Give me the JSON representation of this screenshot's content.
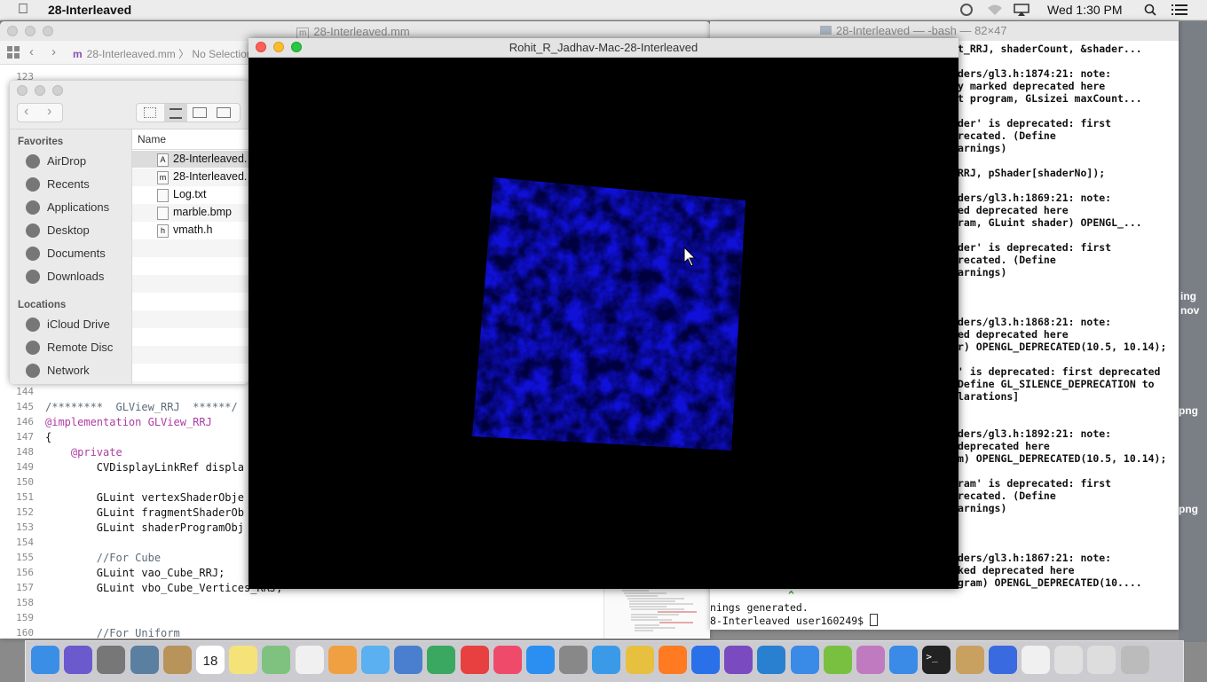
{
  "menubar": {
    "app_name": "28-Interleaved",
    "clock": "Wed 1:30 PM"
  },
  "xcode": {
    "title": "28-Interleaved.mm",
    "breadcrumb_file": "28-Interleaved.mm",
    "breadcrumb_sep": "〉",
    "breadcrumb_selection": "No Selection",
    "top_line_number": "123",
    "lines": [
      {
        "n": "144",
        "text": ""
      },
      {
        "n": "145",
        "text": "/********  GLView_RRJ  ******/",
        "kind": "comment"
      },
      {
        "n": "146",
        "text": "@implementation GLView_RRJ",
        "kind": "impl"
      },
      {
        "n": "147",
        "text": "{"
      },
      {
        "n": "148",
        "text": "    @private",
        "kind": "keyword"
      },
      {
        "n": "149",
        "text": "        CVDisplayLinkRef displa"
      },
      {
        "n": "150",
        "text": ""
      },
      {
        "n": "151",
        "text": "        GLuint vertexShaderObje"
      },
      {
        "n": "152",
        "text": "        GLuint fragmentShaderOb"
      },
      {
        "n": "153",
        "text": "        GLuint shaderProgramObj"
      },
      {
        "n": "154",
        "text": ""
      },
      {
        "n": "155",
        "text": "        //For Cube",
        "kind": "comment"
      },
      {
        "n": "156",
        "text": "        GLuint vao_Cube_RRJ;"
      },
      {
        "n": "157",
        "text": "        GLuint vbo_Cube_Vertices_RRJ;"
      },
      {
        "n": "158",
        "text": ""
      },
      {
        "n": "159",
        "text": ""
      },
      {
        "n": "160",
        "text": "        //For Uniform",
        "kind": "comment"
      }
    ]
  },
  "terminal": {
    "title": "28-Interleaved — -bash — 82×47",
    "lines": [
      "t_RRJ, shaderCount, &shader...",
      "",
      "ders/gl3.h:1874:21: note:",
      "y marked deprecated here",
      "t program, GLsizei maxCount...",
      "",
      "der' is deprecated: first",
      "recated. (Define",
      "arnings)",
      "",
      "RRJ, pShader[shaderNo]);",
      "",
      "ders/gl3.h:1869:21: note:",
      "ed deprecated here",
      "ram, GLuint shader) OPENGL_...",
      "",
      "der' is deprecated: first",
      "recated. (Define",
      "arnings)",
      "",
      "",
      "",
      "ders/gl3.h:1868:21: note:",
      "ed deprecated here",
      "r) OPENGL_DEPRECATED(10.5, 10.14);",
      "",
      "' is deprecated: first deprecated",
      "Define GL_SILENCE_DEPRECATION to",
      "larations]",
      "",
      "",
      "ders/gl3.h:1892:21: note:",
      "deprecated here",
      "m) OPENGL_DEPRECATED(10.5, 10.14);",
      "",
      "ram' is deprecated: first",
      "recated. (Define",
      "arnings)",
      "",
      "",
      "",
      "ders/gl3.h:1867:21: note:",
      "ked deprecated here",
      "gram) OPENGL_DEPRECATED(10...."
    ],
    "caret_line": "^",
    "warnings_line": "nings generated.",
    "prompt_line": "8-Interleaved user160249$ "
  },
  "desktop": {
    "labels": [
      "ing",
      "nov",
      "png",
      "png"
    ]
  },
  "finder": {
    "favorites_header": "Favorites",
    "locations_header": "Locations",
    "favorites": [
      {
        "label": "AirDrop",
        "icon": "airdrop-icon"
      },
      {
        "label": "Recents",
        "icon": "recents-icon"
      },
      {
        "label": "Applications",
        "icon": "applications-icon"
      },
      {
        "label": "Desktop",
        "icon": "desktop-icon"
      },
      {
        "label": "Documents",
        "icon": "documents-icon"
      },
      {
        "label": "Downloads",
        "icon": "downloads-icon"
      }
    ],
    "locations": [
      {
        "label": "iCloud Drive",
        "icon": "icloud-icon"
      },
      {
        "label": "Remote Disc",
        "icon": "disc-icon"
      },
      {
        "label": "Network",
        "icon": "network-icon"
      }
    ],
    "column_name": "Name",
    "files": [
      {
        "name": "28-Interleaved.",
        "glyph": "A",
        "selected": true
      },
      {
        "name": "28-Interleaved.",
        "glyph": "m",
        "selected": false
      },
      {
        "name": "Log.txt",
        "glyph": "",
        "selected": false
      },
      {
        "name": "marble.bmp",
        "glyph": "",
        "selected": false
      },
      {
        "name": "vmath.h",
        "glyph": "h",
        "selected": false
      }
    ]
  },
  "gl_window": {
    "title": "Rohit_R_Jadhav-Mac-28-Interleaved",
    "quad_color": "#1010d8"
  },
  "dock": {
    "apps": [
      "finder-icon",
      "siri-icon",
      "launchpad-icon",
      "preview-icon",
      "contacts-icon",
      "calendar-icon",
      "notes-icon",
      "maps-icon",
      "reminders-icon",
      "photos-icon",
      "messages-icon",
      "keynote-icon",
      "numbers-icon",
      "news-icon",
      "music-icon",
      "appstore-icon",
      "settings-icon",
      "safari-icon",
      "chrome-icon",
      "firefox-icon",
      "dropbox-icon",
      "visualstudio-icon",
      "vscode-icon",
      "xcode-icon",
      "android-studio-icon",
      "instruments-icon",
      "xcode2-icon",
      "terminal-icon",
      "folder-icon",
      "quicktime-icon",
      "textedit-icon",
      "preview2-icon",
      "screenshot-icon",
      "trash-icon"
    ],
    "calendar_day": "18"
  }
}
